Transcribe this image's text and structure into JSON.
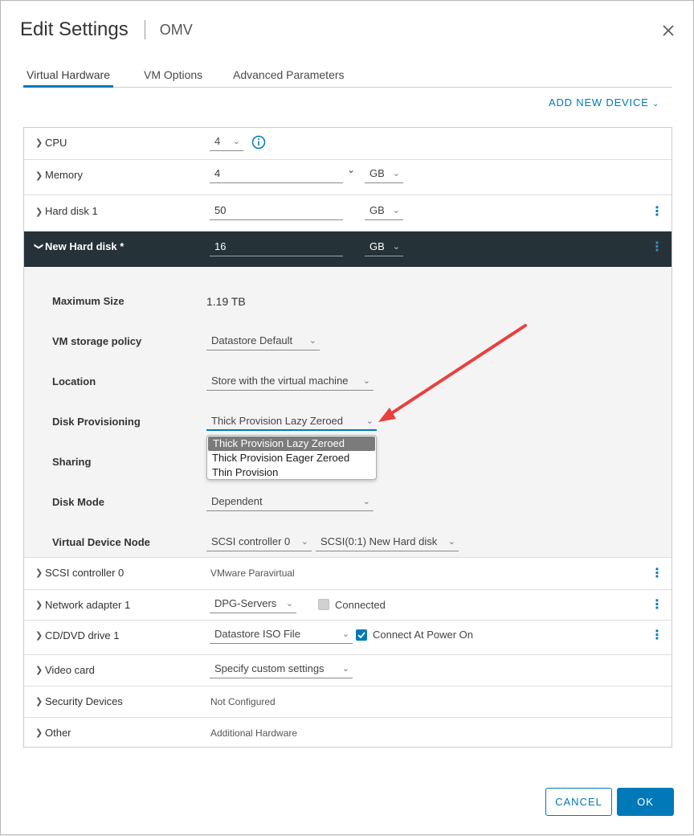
{
  "dialog": {
    "title": "Edit Settings",
    "subtitle": "OMV"
  },
  "tabs": [
    {
      "label": "Virtual Hardware",
      "active": true
    },
    {
      "label": "VM Options",
      "active": false
    },
    {
      "label": "Advanced Parameters",
      "active": false
    }
  ],
  "add_new_device": "ADD NEW DEVICE",
  "devices": {
    "cpu": {
      "label": "CPU",
      "value": "4"
    },
    "memory": {
      "label": "Memory",
      "value": "4",
      "unit": "GB"
    },
    "hard_disk_1": {
      "label": "Hard disk 1",
      "value": "50",
      "unit": "GB"
    },
    "new_hard_disk": {
      "label": "New Hard disk *",
      "value": "16",
      "unit": "GB"
    },
    "scsi": {
      "label": "SCSI controller 0",
      "value": "VMware Paravirtual"
    },
    "network": {
      "label": "Network adapter 1",
      "value": "DPG-Servers",
      "connected_label": "Connected",
      "connected": false
    },
    "cddvd": {
      "label": "CD/DVD drive 1",
      "value": "Datastore ISO File",
      "connect_label": "Connect At Power On",
      "connect": true
    },
    "video": {
      "label": "Video card",
      "value": "Specify custom settings"
    },
    "security": {
      "label": "Security Devices",
      "value": "Not Configured"
    },
    "other": {
      "label": "Other",
      "value": "Additional Hardware"
    }
  },
  "new_disk_props": {
    "max_size": {
      "label": "Maximum Size",
      "value": "1.19 TB"
    },
    "storage_policy": {
      "label": "VM storage policy",
      "value": "Datastore Default"
    },
    "location": {
      "label": "Location",
      "value": "Store with the virtual machine"
    },
    "provisioning": {
      "label": "Disk Provisioning",
      "value": "Thick Provision Lazy Zeroed"
    },
    "sharing": {
      "label": "Sharing"
    },
    "disk_mode": {
      "label": "Disk Mode",
      "value": "Dependent"
    },
    "device_node": {
      "label": "Virtual Device Node",
      "controller": "SCSI controller 0",
      "node": "SCSI(0:1) New Hard disk"
    }
  },
  "provisioning_options": [
    "Thick Provision Lazy Zeroed",
    "Thick Provision Eager Zeroed",
    "Thin Provision"
  ],
  "buttons": {
    "cancel": "CANCEL",
    "ok": "OK"
  },
  "colors": {
    "accent": "#0079b8",
    "header_dark": "#253238",
    "annotation_arrow": "#e8403f"
  }
}
